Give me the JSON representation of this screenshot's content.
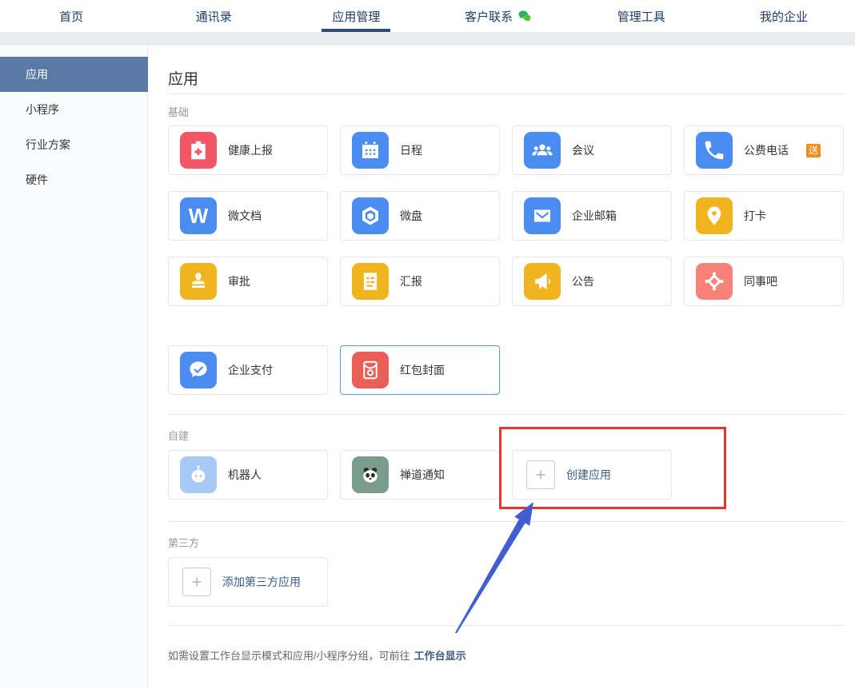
{
  "nav": {
    "items": [
      {
        "label": "首页",
        "active": false
      },
      {
        "label": "通讯录",
        "active": false
      },
      {
        "label": "应用管理",
        "active": true
      },
      {
        "label": "客户联系",
        "active": false,
        "icon": "wechat-bubbles-icon"
      },
      {
        "label": "管理工具",
        "active": false
      },
      {
        "label": "我的企业",
        "active": false
      }
    ],
    "text_color": "#1e3d68",
    "active_underline_color": "#2f4d73"
  },
  "sidebar": {
    "active_bg": "#587aa5",
    "items": [
      {
        "label": "应用",
        "active": true
      },
      {
        "label": "小程序",
        "active": false
      },
      {
        "label": "行业方案",
        "active": false
      },
      {
        "label": "硬件",
        "active": false
      }
    ]
  },
  "page": {
    "title": "应用"
  },
  "apps": {
    "basic": {
      "label": "基础",
      "items": [
        {
          "name": "健康上报",
          "icon": "health-report-icon",
          "color": "#f25565"
        },
        {
          "name": "日程",
          "icon": "calendar-icon",
          "color": "#4a8cf0"
        },
        {
          "name": "会议",
          "icon": "meeting-icon",
          "color": "#4a8cf0"
        },
        {
          "name": "公费电话",
          "icon": "phone-icon",
          "color": "#4a8cf0",
          "badge": "送",
          "badge_color": "#f28a1d"
        },
        {
          "name": "微文档",
          "icon": "doc-w-icon",
          "color": "#4a8cf0",
          "icon_letter": "W"
        },
        {
          "name": "微盘",
          "icon": "drive-icon",
          "color": "#4a8cf0"
        },
        {
          "name": "企业邮箱",
          "icon": "mail-icon",
          "color": "#4a8cf0"
        },
        {
          "name": "打卡",
          "icon": "location-pin-icon",
          "color": "#f0b41e"
        },
        {
          "name": "审批",
          "icon": "approval-stamp-icon",
          "color": "#f0b41e"
        },
        {
          "name": "汇报",
          "icon": "report-doc-icon",
          "color": "#f0b41e"
        },
        {
          "name": "公告",
          "icon": "megaphone-icon",
          "color": "#f0b41e"
        },
        {
          "name": "同事吧",
          "icon": "colleague-diamond-icon",
          "color": "#f8827a"
        }
      ]
    },
    "payment": {
      "items": [
        {
          "name": "企业支付",
          "icon": "pay-bubble-icon",
          "color": "#4a8cf0"
        },
        {
          "name": "红包封面",
          "icon": "red-packet-icon",
          "color": "#e95f58",
          "selected": true
        }
      ]
    },
    "custom": {
      "label": "自建",
      "items": [
        {
          "name": "机器人",
          "icon": "robot-icon",
          "color": "#a7c9f6"
        },
        {
          "name": "禅道通知",
          "icon": "panda-photo-icon",
          "color": "#7a9c8a"
        }
      ],
      "create_label": "创建应用"
    },
    "third_party": {
      "label": "第三方",
      "add_label": "添加第三方应用"
    }
  },
  "footer": {
    "text": "如需设置工作台显示模式和应用/小程序分组，可前往",
    "link": "工作台显示"
  },
  "annotation": {
    "box_color": "#e8362c",
    "arrow_color": "#3e5ed2"
  }
}
